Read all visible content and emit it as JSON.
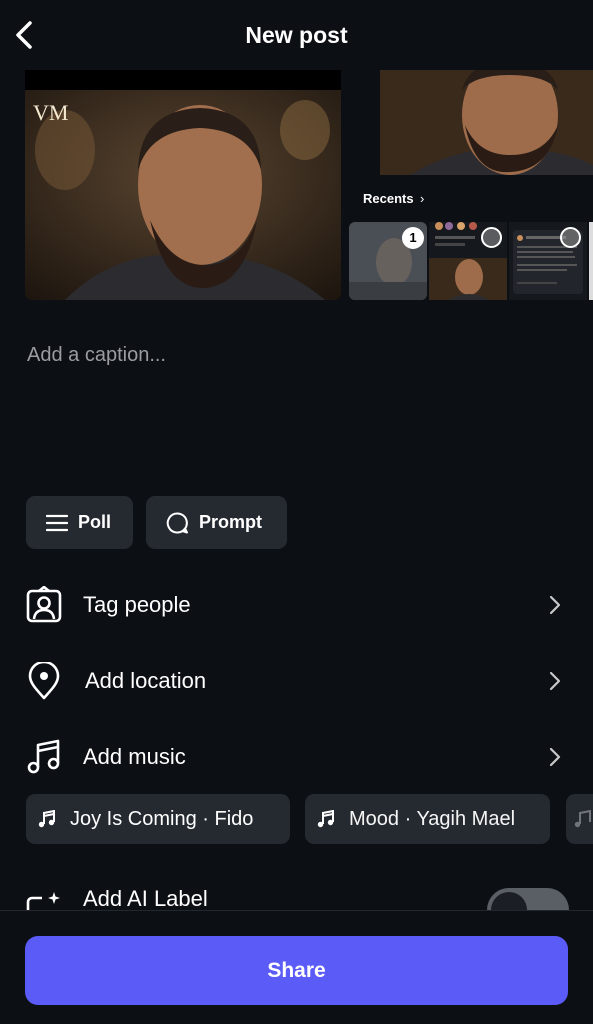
{
  "header": {
    "title": "New post"
  },
  "media": {
    "watermark": "VM",
    "recents_label": "Recents",
    "selected_count": "1"
  },
  "caption": {
    "placeholder": "Add a caption..."
  },
  "chips": {
    "poll": "Poll",
    "prompt": "Prompt"
  },
  "rows": {
    "tag_people": "Tag people",
    "add_location": "Add location",
    "add_music": "Add music",
    "add_ai_label": "Add AI Label"
  },
  "music_suggestions": [
    {
      "text": "Joy Is Coming · Fido"
    },
    {
      "text": "Mood · Yagih Mael"
    }
  ],
  "ai_label": {
    "enabled": false
  },
  "share": {
    "label": "Share"
  },
  "colors": {
    "accent": "#5b5bf7",
    "background": "#0c0f14",
    "chip": "#252a31"
  }
}
